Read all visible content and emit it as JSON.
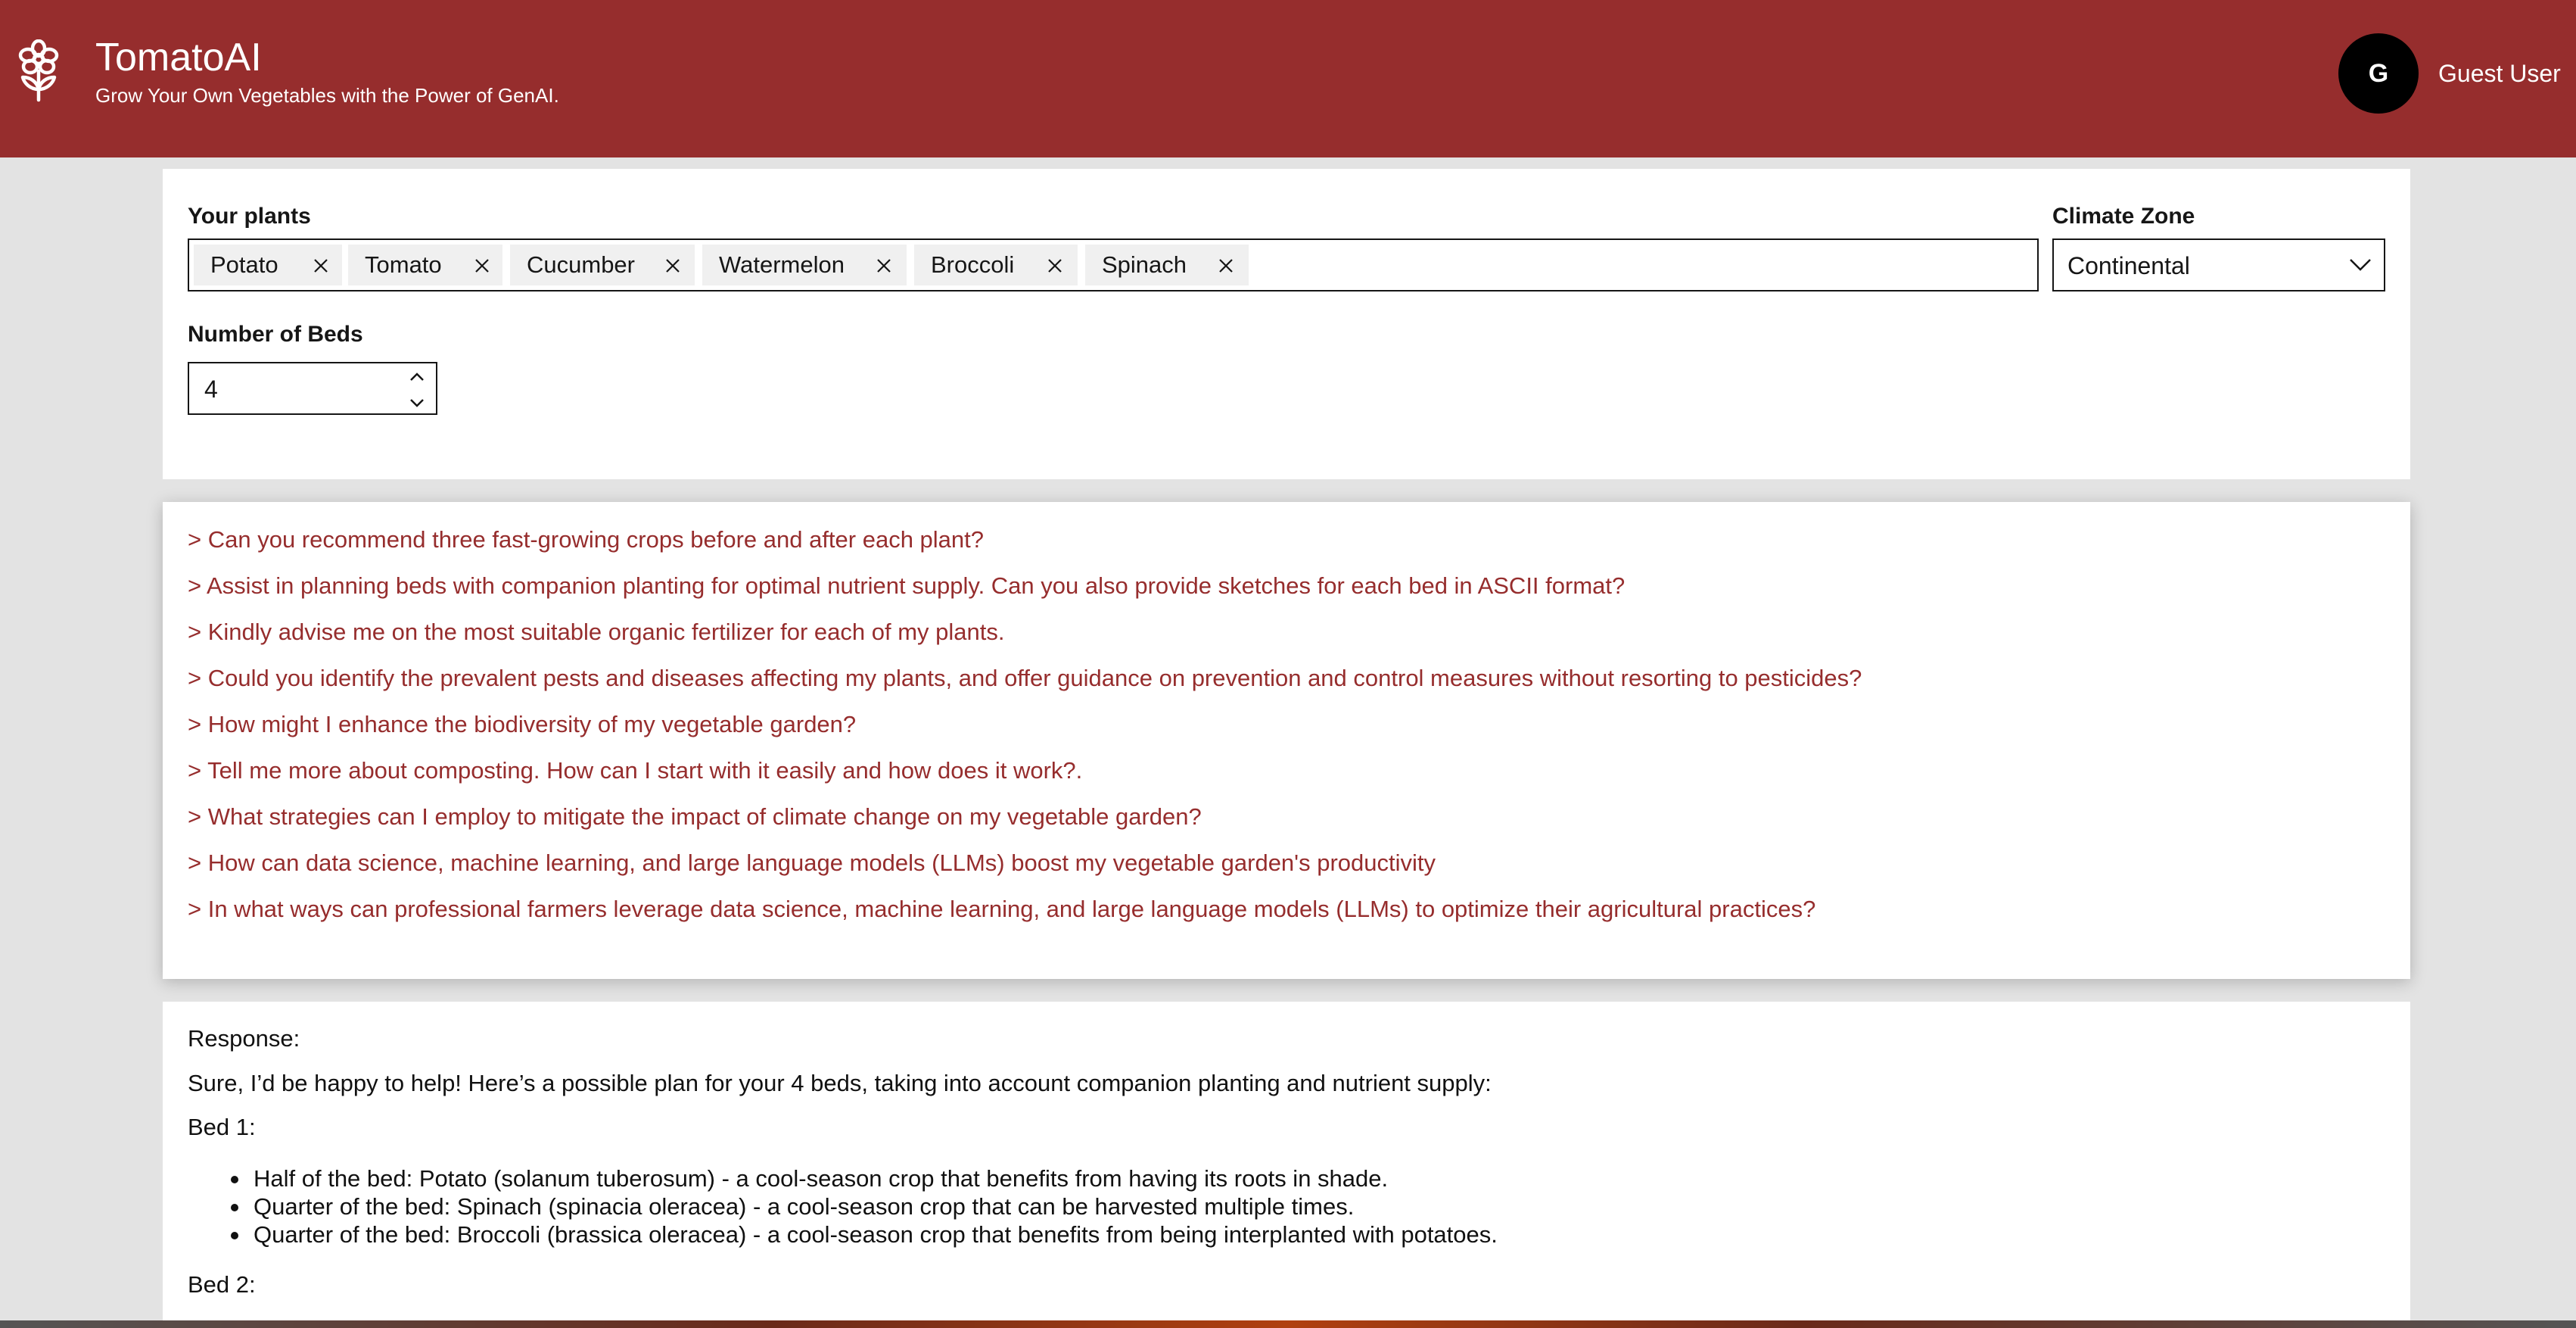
{
  "header": {
    "title": "TomatoAI",
    "subtitle": "Grow Your Own Vegetables with the Power of GenAI.",
    "logo_icon": "flower-icon",
    "avatar_initial": "G",
    "user_name": "Guest User",
    "brand_color": "#962d2d"
  },
  "form": {
    "plants_label": "Your plants",
    "plants": [
      "Potato",
      "Tomato",
      "Cucumber",
      "Watermelon",
      "Broccoli",
      "Spinach"
    ],
    "climate_label": "Climate Zone",
    "climate_value": "Continental",
    "beds_label": "Number of Beds",
    "beds_value": "4"
  },
  "prompts": [
    "> Can you recommend three fast-growing crops before and after each plant?",
    "> Assist in planning beds with companion planting for optimal nutrient supply. Can you also provide sketches for each bed in ASCII format?",
    "> Kindly advise me on the most suitable organic fertilizer for each of my plants.",
    "> Could you identify the prevalent pests and diseases affecting my plants, and offer guidance on prevention and control measures without resorting to pesticides?",
    "> How might I enhance the biodiversity of my vegetable garden?",
    "> Tell me more about composting. How can I start with it easily and how does it work?.",
    "> What strategies can I employ to mitigate the impact of climate change on my vegetable garden?",
    "> How can data science, machine learning, and large language models (LLMs) boost my vegetable garden's productivity",
    "> In what ways can professional farmers leverage data science, machine learning, and large language models (LLMs) to optimize their agricultural practices?"
  ],
  "response": {
    "heading": "Response:",
    "intro": "Sure, I’d be happy to help! Here’s a possible plan for your 4 beds, taking into account companion planting and nutrient supply:",
    "bed1_title": "Bed 1:",
    "bed1_items": [
      "Half of the bed: Potato (solanum tuberosum) - a cool-season crop that benefits from having its roots in shade.",
      "Quarter of the bed: Spinach (spinacia oleracea) - a cool-season crop that can be harvested multiple times.",
      "Quarter of the bed: Broccoli (brassica oleracea) - a cool-season crop that benefits from being interplanted with potatoes."
    ],
    "bed2_title": "Bed 2:"
  }
}
